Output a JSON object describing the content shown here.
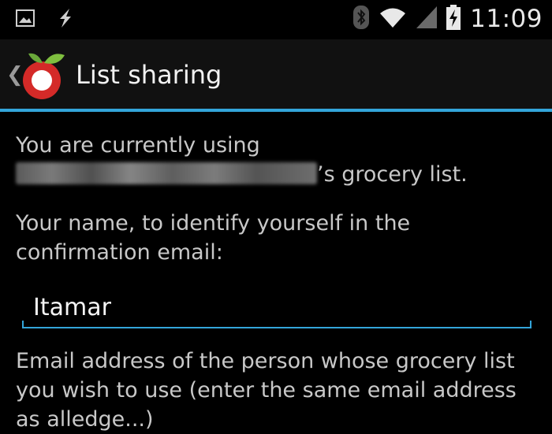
{
  "status_bar": {
    "time": "11:09",
    "icons": [
      "image-icon",
      "flash-icon",
      "bluetooth-icon",
      "wifi-icon",
      "signal-icon",
      "battery-charging-icon"
    ]
  },
  "action_bar": {
    "title": "List sharing",
    "logo": "app-logo-tomato"
  },
  "content": {
    "using_prefix": "You are currently using",
    "using_suffix": "’s grocery list.",
    "name_label": "Your name, to identify yourself in the confirmation email:",
    "name_value": "Itamar",
    "email_label": "Email address of the person whose grocery list you wish to use (enter the same email address as alledge...)"
  },
  "colors": {
    "accent": "#33a5da",
    "background": "#000000",
    "actionbar": "#111111"
  }
}
